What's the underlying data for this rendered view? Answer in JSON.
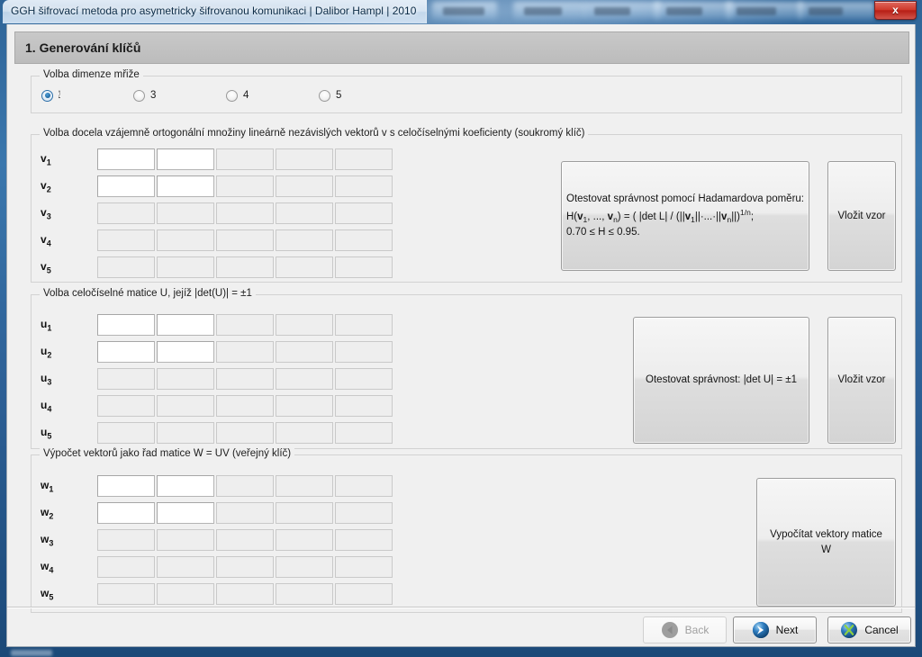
{
  "window": {
    "title": "GGH šifrovací metoda pro asymetricky šifrovanou komunikaci | Dalibor Hampl | 2010",
    "close_label": "x"
  },
  "header": {
    "title": "1. Generování klíčů"
  },
  "dimension_group": {
    "legend": "Volba dimenze mřiže",
    "options": [
      {
        "label": "2",
        "checked": true
      },
      {
        "label": "3",
        "checked": false
      },
      {
        "label": "4",
        "checked": false
      },
      {
        "label": "5",
        "checked": false
      }
    ]
  },
  "v_group": {
    "legend": "Volba docela vzájemně ortogonální množiny lineárně nezávislých vektorů v s celočíselnými koeficienty (soukromý klíč)",
    "row_labels": [
      "v1",
      "v2",
      "v3",
      "v4",
      "v5"
    ],
    "row_symbol": "v",
    "rows": [
      {
        "sub": "1",
        "cells": [
          "",
          "",
          "",
          "",
          ""
        ],
        "enabled": [
          true,
          true,
          false,
          false,
          false
        ]
      },
      {
        "sub": "2",
        "cells": [
          "",
          "",
          "",
          "",
          ""
        ],
        "enabled": [
          true,
          true,
          false,
          false,
          false
        ]
      },
      {
        "sub": "3",
        "cells": [
          "",
          "",
          "",
          "",
          ""
        ],
        "enabled": [
          false,
          false,
          false,
          false,
          false
        ]
      },
      {
        "sub": "4",
        "cells": [
          "",
          "",
          "",
          "",
          ""
        ],
        "enabled": [
          false,
          false,
          false,
          false,
          false
        ]
      },
      {
        "sub": "5",
        "cells": [
          "",
          "",
          "",
          "",
          ""
        ],
        "enabled": [
          false,
          false,
          false,
          false,
          false
        ]
      }
    ],
    "test_button": {
      "line1": "Otestovat správnost pomocí Hadamardova poměru:",
      "line2_a": "H(",
      "line2_v1": "v",
      "line2_v1sub": "1",
      "line2_b": ", ..., ",
      "line2_vn": "v",
      "line2_vnsub": "n",
      "line2_c": ") = ( |det L| / (||",
      "line2_v1b": "v",
      "line2_v1bsub": "1",
      "line2_d": "||·...·||",
      "line2_vnb": "v",
      "line2_vnbsub": "n",
      "line2_e": "||)",
      "line2_exp": "1/n",
      "line2_f": ";",
      "line3": "0.70 ≤ H ≤ 0.95."
    },
    "sample_button_label": "Vložit vzor"
  },
  "u_group": {
    "legend": "Volba celočíselné matice U, jejíž |det(U)| = ±1",
    "row_symbol": "u",
    "rows": [
      {
        "sub": "1",
        "enabled": [
          true,
          true,
          false,
          false,
          false
        ]
      },
      {
        "sub": "2",
        "enabled": [
          true,
          true,
          false,
          false,
          false
        ]
      },
      {
        "sub": "3",
        "enabled": [
          false,
          false,
          false,
          false,
          false
        ]
      },
      {
        "sub": "4",
        "enabled": [
          false,
          false,
          false,
          false,
          false
        ]
      },
      {
        "sub": "5",
        "enabled": [
          false,
          false,
          false,
          false,
          false
        ]
      }
    ],
    "test_button_label": "Otestovat správnost: |det U| = ±1",
    "sample_button_label": "Vložit vzor"
  },
  "w_group": {
    "legend": "Výpočet vektorů jako řad matice W = UV (veřejný klíč)",
    "row_symbol": "w",
    "rows": [
      {
        "sub": "1",
        "enabled": [
          true,
          true,
          false,
          false,
          false
        ]
      },
      {
        "sub": "2",
        "enabled": [
          true,
          true,
          false,
          false,
          false
        ]
      },
      {
        "sub": "3",
        "enabled": [
          false,
          false,
          false,
          false,
          false
        ]
      },
      {
        "sub": "4",
        "enabled": [
          false,
          false,
          false,
          false,
          false
        ]
      },
      {
        "sub": "5",
        "enabled": [
          false,
          false,
          false,
          false,
          false
        ]
      }
    ],
    "compute_button_label": "Vypočítat vektory matice W"
  },
  "footer": {
    "back_label": "Back",
    "next_label": "Next",
    "cancel_label": "Cancel"
  },
  "colors": {
    "accent_blue": "#1f63a5",
    "close_red": "#cf3a2c",
    "cancel_green": "#7ac143",
    "header_gray": "#c2c2c2"
  }
}
